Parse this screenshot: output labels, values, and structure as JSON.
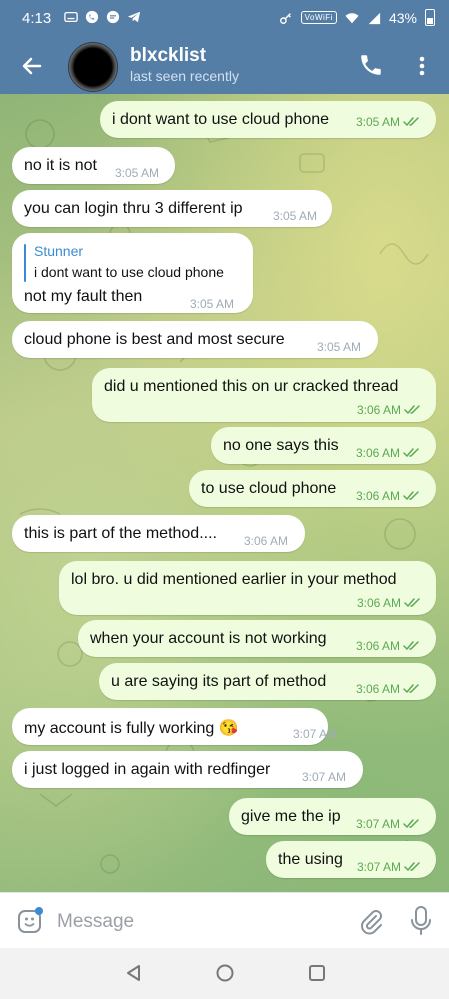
{
  "status_bar": {
    "time": "4:13",
    "wifi_label": "VoWiFi",
    "battery": "43%"
  },
  "header": {
    "title": "blxcklist",
    "subtitle": "last seen recently"
  },
  "messages": [
    {
      "dir": "out",
      "text": "i dont want to use cloud phone",
      "time": "3:05 AM",
      "read": true
    },
    {
      "dir": "in",
      "text": "no it is not",
      "time": "3:05 AM"
    },
    {
      "dir": "in",
      "text": "you can login thru 3 different ip",
      "time": "3:05 AM"
    },
    {
      "dir": "in",
      "text": "not my fault then",
      "time": "3:05 AM",
      "reply": {
        "name": "Stunner",
        "text": "i dont want to use cloud phone"
      }
    },
    {
      "dir": "in",
      "text": "cloud phone is best and most secure",
      "time": "3:05 AM"
    },
    {
      "dir": "out",
      "text": "did u mentioned this on ur cracked thread",
      "time": "3:06 AM",
      "read": true
    },
    {
      "dir": "out",
      "text": "no one says this",
      "time": "3:06 AM",
      "read": true
    },
    {
      "dir": "out",
      "text": "to use cloud phone",
      "time": "3:06 AM",
      "read": true
    },
    {
      "dir": "in",
      "text": "this is part of the method....",
      "time": "3:06 AM"
    },
    {
      "dir": "out",
      "text": "lol bro. u did mentioned earlier in your method",
      "time": "3:06 AM",
      "read": true
    },
    {
      "dir": "out",
      "text": "when your account is not working",
      "time": "3:06 AM",
      "read": true
    },
    {
      "dir": "out",
      "text": "u are saying its part of method",
      "time": "3:06 AM",
      "read": true
    },
    {
      "dir": "in",
      "text": "my account is fully working 😘",
      "time": "3:07 AM"
    },
    {
      "dir": "in",
      "text": "i just logged in again with redfinger",
      "time": "3:07 AM"
    },
    {
      "dir": "out",
      "text": "give me the ip",
      "time": "3:07 AM",
      "read": true
    },
    {
      "dir": "out",
      "text": "the using",
      "time": "3:07 AM",
      "read": true
    }
  ],
  "input": {
    "placeholder": "Message"
  },
  "icons": {
    "back": "arrow-left-icon",
    "call": "phone-icon",
    "menu": "more-vertical-icon",
    "emoji": "sticker-icon",
    "attach": "paperclip-icon",
    "mic": "microphone-icon",
    "scroll": "chevron-down-icon"
  },
  "colors": {
    "header": "#557ea6",
    "incoming_bubble": "#ffffff",
    "outgoing_bubble": "#effdde",
    "outgoing_time": "#5ca853",
    "reply_accent": "#3b8bd4"
  }
}
